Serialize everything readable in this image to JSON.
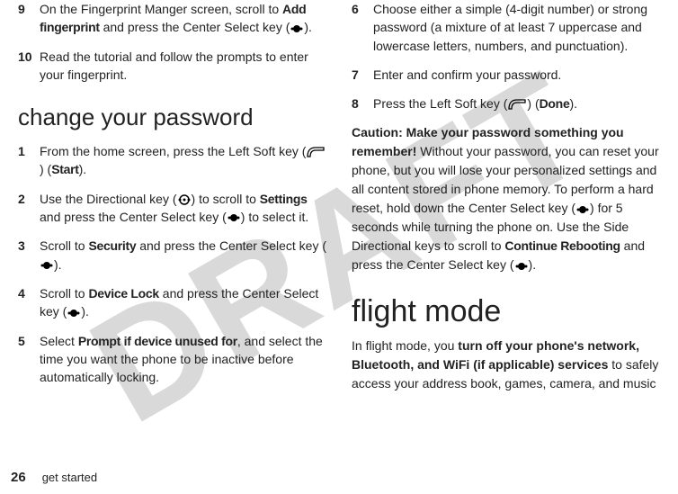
{
  "watermark": "DRAFT",
  "footer": {
    "page_number": "26",
    "section_label": "get started"
  },
  "left_col": {
    "steps_top": [
      {
        "num": "9",
        "pre": "On the Fingerprint Manger screen, scroll to ",
        "bold1": "Add fingerprint",
        "mid1": " and press the Center Select key (",
        "icon1": "center-select",
        "post1": ")."
      },
      {
        "num": "10",
        "pre": "Read the tutorial and follow the prompts to enter your fingerprint.",
        "bold1": "",
        "mid1": "",
        "icon1": "",
        "post1": ""
      }
    ],
    "heading": "change your password",
    "steps_bottom": [
      {
        "num": "1",
        "pre": "From the home screen, press the Left Soft key (",
        "icon1": "left-soft",
        "mid1": ") (",
        "bold1": "Start",
        "post1": ")."
      },
      {
        "num": "2",
        "pre": "Use the Directional key (",
        "icon1": "directional",
        "mid1": ") to scroll to ",
        "bold1": "Settings",
        "mid2": " and press the Center Select key (",
        "icon2": "center-select",
        "post1": ") to select it."
      },
      {
        "num": "3",
        "pre": "Scroll to ",
        "bold1": "Security",
        "mid1": " and press the Center Select key (",
        "icon1": "center-select",
        "post1": ")."
      },
      {
        "num": "4",
        "pre": "Scroll to ",
        "bold1": "Device Lock",
        "mid1": " and press the Center Select key (",
        "icon1": "center-select",
        "post1": ")."
      },
      {
        "num": "5",
        "pre": "Select ",
        "bold1": "Prompt if device unused for",
        "mid1": ", and select the time you want the phone to be inactive before automatically locking.",
        "icon1": "",
        "post1": ""
      }
    ]
  },
  "right_col": {
    "steps_top": [
      {
        "num": "6",
        "pre": "Choose either a simple (4-digit number) or strong password (a mixture of at least 7 uppercase and lowercase letters, numbers, and punctuation).",
        "bold1": "",
        "mid1": "",
        "icon1": "",
        "post1": ""
      },
      {
        "num": "7",
        "pre": "Enter and confirm your password.",
        "bold1": "",
        "mid1": "",
        "icon1": "",
        "post1": ""
      },
      {
        "num": "8",
        "pre": "Press the Left Soft key (",
        "icon1": "left-soft",
        "mid1": ") (",
        "bold1": "Done",
        "post1": ")."
      }
    ],
    "caution": {
      "bold_start": "Caution: Make your password something you remember!",
      "body1": " Without your password, you can reset your phone, but you will lose your personalized settings and all content stored in phone memory. To perform a hard reset, hold down the Center Select key (",
      "icon1": "center-select",
      "body2": ") for 5 seconds while turning the phone on. Use the Side Directional keys to scroll to ",
      "bold_mid": "Continue Rebooting",
      "body3": " and press the Center Select key (",
      "icon2": "center-select",
      "body4": ")."
    },
    "heading": "flight mode",
    "flight_body": {
      "pre": "In flight mode, you ",
      "bold": "turn off your phone's network, Bluetooth, and WiFi (if applicable) services",
      "post": " to safely access your address book, games, camera, and music"
    }
  }
}
